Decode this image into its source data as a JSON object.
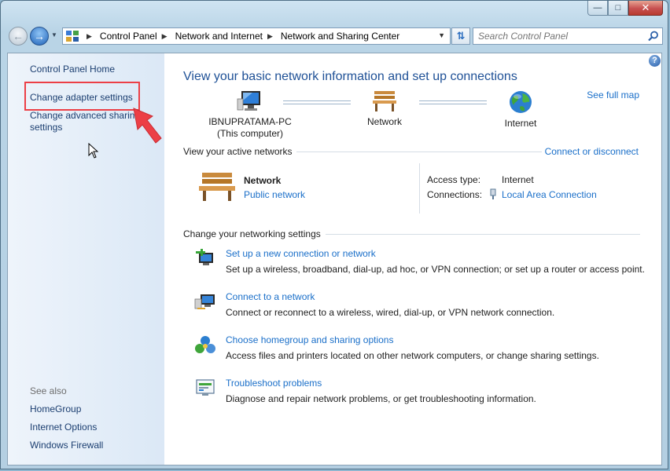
{
  "window": {
    "controls": {
      "minimize": "—",
      "maximize": "□",
      "close": "✕"
    }
  },
  "address_bar": {
    "breadcrumbs": [
      "Control Panel",
      "Network and Internet",
      "Network and Sharing Center"
    ],
    "search_placeholder": "Search Control Panel"
  },
  "sidebar": {
    "items": [
      {
        "label": "Control Panel Home"
      },
      {
        "label": "Change adapter settings"
      },
      {
        "label": "Change advanced sharing settings"
      }
    ],
    "see_also_heading": "See also",
    "see_also": [
      {
        "label": "HomeGroup"
      },
      {
        "label": "Internet Options"
      },
      {
        "label": "Windows Firewall"
      }
    ]
  },
  "main": {
    "title": "View your basic network information and set up connections",
    "see_full_map": "See full map",
    "map": {
      "computer_name": "IBNUPRATAMA-PC",
      "computer_sub": "(This computer)",
      "network": "Network",
      "internet": "Internet"
    },
    "active_networks": {
      "heading": "View your active networks",
      "connect_link": "Connect or disconnect",
      "network_name": "Network",
      "network_type": "Public network",
      "access_type_label": "Access type:",
      "access_type_value": "Internet",
      "connections_label": "Connections:",
      "connections_value": "Local Area Connection"
    },
    "change_settings": {
      "heading": "Change your networking settings",
      "tasks": [
        {
          "title": "Set up a new connection or network",
          "desc": "Set up a wireless, broadband, dial-up, ad hoc, or VPN connection; or set up a router or access point."
        },
        {
          "title": "Connect to a network",
          "desc": "Connect or reconnect to a wireless, wired, dial-up, or VPN network connection."
        },
        {
          "title": "Choose homegroup and sharing options",
          "desc": "Access files and printers located on other network computers, or change sharing settings."
        },
        {
          "title": "Troubleshoot problems",
          "desc": "Diagnose and repair network problems, or get troubleshooting information."
        }
      ]
    }
  },
  "colors": {
    "link": "#1a6fc9",
    "title": "#1e5096",
    "annotation_red": "#ec3f46"
  }
}
